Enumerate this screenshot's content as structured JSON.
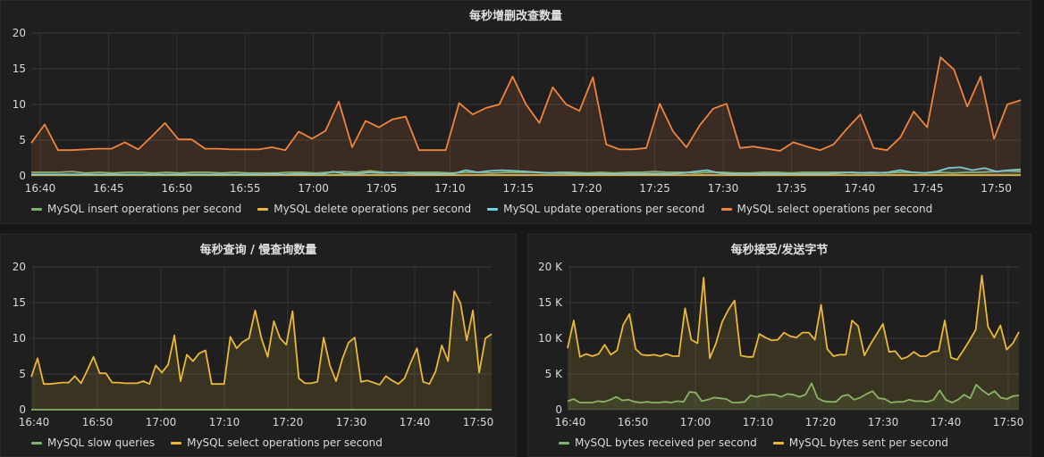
{
  "panels": [
    {
      "title": "每秒增删改查数量",
      "chart_data": {
        "type": "area",
        "x_ticks": [
          "16:40",
          "16:45",
          "16:50",
          "16:55",
          "17:00",
          "17:05",
          "17:10",
          "17:15",
          "17:20",
          "17:25",
          "17:30",
          "17:35",
          "17:40",
          "17:45",
          "17:50"
        ],
        "y_ticks": [
          "0",
          "5",
          "10",
          "15",
          "20"
        ],
        "ylim": [
          0,
          20
        ],
        "x_range_minutes": [
          0,
          73
        ],
        "series": [
          {
            "name": "MySQL insert operations per second",
            "color": "#7eb26d",
            "values": [
              0.5,
              0.5,
              0.5,
              0.6,
              0.4,
              0.5,
              0.4,
              0.5,
              0.5,
              0.4,
              0.5,
              0.4,
              0.5,
              0.5,
              0.4,
              0.5,
              0.4,
              0.4,
              0.4,
              0.5,
              0.5,
              0.4,
              0.5,
              0.6,
              0.5,
              0.7,
              0.5,
              0.4,
              0.5,
              0.5,
              0.5,
              0.4,
              0.5,
              0.5,
              0.4,
              0.5,
              0.5,
              0.5,
              0.4,
              0.5,
              0.5,
              0.4,
              0.5,
              0.4,
              0.5,
              0.5,
              0.6,
              0.5,
              0.5,
              0.4,
              0.5,
              0.5,
              0.4,
              0.4,
              0.5,
              0.5,
              0.4,
              0.5,
              0.5,
              0.5,
              0.5,
              0.4,
              0.5,
              0.4,
              0.5,
              0.5,
              0.4,
              0.5,
              0.4,
              0.5,
              0.5,
              0.6,
              0.7,
              0.6
            ]
          },
          {
            "name": "MySQL delete operations per second",
            "color": "#eab839",
            "values": [
              0.1,
              0.1,
              0.1,
              0.1,
              0.1,
              0.1,
              0.1,
              0.1,
              0.1,
              0.1,
              0.1,
              0.1,
              0.1,
              0.1,
              0.1,
              0.1,
              0.1,
              0.1,
              0.1,
              0.1,
              0.1,
              0.1,
              0.1,
              0.1,
              0.1,
              0.1,
              0.1,
              0.1,
              0.1,
              0.1,
              0.1,
              0.1,
              0.1,
              0.1,
              0.1,
              0.1,
              0.1,
              0.1,
              0.1,
              0.1,
              0.1,
              0.1,
              0.1,
              0.1,
              0.1,
              0.1,
              0.1,
              0.1,
              0.1,
              0.1,
              0.1,
              0.1,
              0.1,
              0.1,
              0.1,
              0.1,
              0.1,
              0.1,
              0.1,
              0.1,
              0.1,
              0.1,
              0.1,
              0.1,
              0.1,
              0.1,
              0.1,
              0.1,
              0.1,
              0.1,
              0.1,
              0.1,
              0.1,
              0.1
            ]
          },
          {
            "name": "MySQL update operations per second",
            "color": "#6ed0e0",
            "values": [
              0.2,
              0.2,
              0.2,
              0.2,
              0.2,
              0.2,
              0.2,
              0.2,
              0.2,
              0.2,
              0.2,
              0.2,
              0.2,
              0.2,
              0.2,
              0.2,
              0.2,
              0.2,
              0.2,
              0.2,
              0.3,
              0.2,
              0.3,
              0.3,
              0.2,
              0.6,
              0.3,
              0.3,
              0.5,
              0.4,
              0.5,
              0.4,
              0.3,
              0.3,
              0.3,
              0.3,
              0.8,
              0.5,
              0.7,
              0.8,
              0.7,
              0.6,
              0.5,
              0.4,
              0.4,
              0.3,
              0.3,
              0.3,
              0.3,
              0.3,
              0.3,
              0.3,
              0.3,
              0.3,
              0.4,
              0.6,
              0.8,
              0.4,
              0.3,
              0.3,
              0.3,
              0.3,
              0.3,
              0.3,
              0.3,
              0.3,
              0.3,
              0.4,
              0.5,
              0.4,
              0.4,
              0.5,
              0.8,
              0.5,
              0.4,
              0.6,
              1.1,
              1.2,
              0.8,
              1.1,
              0.6,
              0.8,
              0.9
            ]
          },
          {
            "name": "MySQL select operations per second",
            "color": "#ef843c",
            "values": [
              4.6,
              7.2,
              3.6,
              3.6,
              3.7,
              3.8,
              3.8,
              4.7,
              3.7,
              5.5,
              7.4,
              5.1,
              5.1,
              3.8,
              3.8,
              3.7,
              3.7,
              3.7,
              4.0,
              3.6,
              6.2,
              5.2,
              6.3,
              10.4,
              4.0,
              7.7,
              6.8,
              7.9,
              8.3,
              3.6,
              3.6,
              3.6,
              10.2,
              8.6,
              9.5,
              10.0,
              13.9,
              10.0,
              7.4,
              12.4,
              10.0,
              9.1,
              13.8,
              4.4,
              3.7,
              3.7,
              3.9,
              10.1,
              6.2,
              4.0,
              7.1,
              9.4,
              10.1,
              3.9,
              4.1,
              3.8,
              3.5,
              4.7,
              4.1,
              3.6,
              4.4,
              6.6,
              8.6,
              3.9,
              3.6,
              5.4,
              9.0,
              6.8,
              16.6,
              14.9,
              9.7,
              13.9,
              5.2,
              10.0,
              10.6
            ]
          }
        ],
        "legend_position": "bottom-left",
        "grid": true
      }
    },
    {
      "title": "每秒查询 / 慢查询数量",
      "chart_data": {
        "type": "area",
        "x_ticks": [
          "16:40",
          "16:50",
          "17:00",
          "17:10",
          "17:20",
          "17:30",
          "17:40",
          "17:50"
        ],
        "y_ticks": [
          "0",
          "5",
          "10",
          "15",
          "20"
        ],
        "ylim": [
          0,
          20
        ],
        "series": [
          {
            "name": "MySQL slow queries",
            "color": "#7eb26d",
            "values": [
              0,
              0,
              0,
              0,
              0,
              0,
              0,
              0,
              0,
              0,
              0,
              0,
              0,
              0,
              0,
              0,
              0,
              0,
              0,
              0,
              0,
              0,
              0,
              0,
              0,
              0,
              0,
              0,
              0,
              0,
              0,
              0,
              0,
              0,
              0,
              0,
              0,
              0,
              0,
              0,
              0,
              0,
              0,
              0,
              0,
              0,
              0,
              0,
              0,
              0,
              0,
              0,
              0,
              0,
              0,
              0,
              0,
              0,
              0,
              0,
              0,
              0,
              0,
              0,
              0,
              0,
              0,
              0,
              0,
              0,
              0,
              0,
              0,
              0,
              0
            ]
          },
          {
            "name": "MySQL select operations per second",
            "color": "#eab839",
            "values": [
              4.6,
              7.2,
              3.6,
              3.6,
              3.7,
              3.8,
              3.8,
              4.7,
              3.7,
              5.5,
              7.4,
              5.1,
              5.1,
              3.8,
              3.8,
              3.7,
              3.7,
              3.7,
              4.0,
              3.6,
              6.2,
              5.2,
              6.3,
              10.4,
              4.0,
              7.7,
              6.8,
              7.9,
              8.3,
              3.6,
              3.6,
              3.6,
              10.2,
              8.6,
              9.5,
              10.0,
              13.9,
              10.0,
              7.4,
              12.4,
              10.0,
              9.1,
              13.8,
              4.4,
              3.7,
              3.7,
              3.9,
              10.1,
              6.2,
              4.0,
              7.1,
              9.4,
              10.1,
              3.9,
              4.1,
              3.8,
              3.5,
              4.7,
              4.1,
              3.6,
              4.4,
              6.6,
              8.6,
              3.9,
              3.6,
              5.4,
              9.0,
              6.8,
              16.6,
              14.9,
              9.7,
              13.9,
              5.2,
              10.0,
              10.6
            ]
          }
        ],
        "legend_position": "bottom-left",
        "grid": true
      }
    },
    {
      "title": "每秒接受/发送字节",
      "chart_data": {
        "type": "area",
        "x_ticks": [
          "16:40",
          "16:50",
          "17:00",
          "17:10",
          "17:20",
          "17:30",
          "17:40",
          "17:50"
        ],
        "y_ticks": [
          "0",
          "5 K",
          "10 K",
          "15 K",
          "20 K"
        ],
        "ylim": [
          0,
          20000
        ],
        "series": [
          {
            "name": "MySQL bytes received per second",
            "color": "#7eb26d",
            "values": [
              1200,
              1500,
              1000,
              1000,
              1000,
              1200,
              1100,
              1400,
              1800,
              1300,
              1400,
              1100,
              1000,
              1100,
              1000,
              1000,
              1100,
              1000,
              1200,
              1100,
              2500,
              2400,
              1200,
              1400,
              1700,
              1600,
              1500,
              1000,
              1000,
              1100,
              2000,
              1800,
              2000,
              2100,
              2100,
              1800,
              2200,
              2100,
              1800,
              2100,
              3700,
              1600,
              1200,
              1100,
              1100,
              1900,
              2100,
              1400,
              1700,
              2200,
              2600,
              1600,
              1500,
              1000,
              1100,
              1100,
              1400,
              1200,
              1200,
              1100,
              1400,
              2700,
              1400,
              1000,
              1400,
              2100,
              1600,
              3500,
              2700,
              2100,
              2600,
              1700,
              1500,
              1900,
              2000
            ]
          },
          {
            "name": "MySQL bytes sent per second",
            "color": "#eab839",
            "values": [
              8600,
              12500,
              7400,
              7800,
              7500,
              7800,
              9100,
              7700,
              8300,
              11900,
              13400,
              8500,
              7700,
              7600,
              7700,
              7500,
              7800,
              7500,
              7500,
              14200,
              9800,
              9300,
              18500,
              7200,
              9300,
              12300,
              14000,
              15300,
              7600,
              7400,
              7400,
              10600,
              10100,
              9700,
              9800,
              10800,
              10300,
              10100,
              10800,
              10800,
              9800,
              14700,
              8500,
              7500,
              7700,
              7700,
              12500,
              11700,
              7600,
              9200,
              10600,
              12000,
              8100,
              8200,
              7100,
              7400,
              8100,
              7500,
              7500,
              8100,
              8200,
              12500,
              7300,
              7000,
              8300,
              9700,
              11200,
              18800,
              11600,
              10100,
              11800,
              8400,
              9300,
              10900
            ]
          }
        ],
        "legend_position": "bottom-left",
        "grid": true
      }
    }
  ]
}
